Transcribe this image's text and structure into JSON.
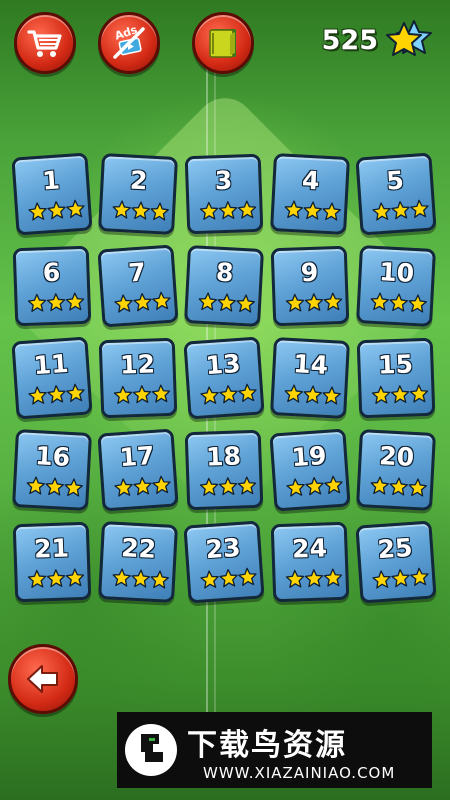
{
  "header": {
    "score": "525",
    "buttons": [
      {
        "name": "shop",
        "icon": "shopping-cart-icon"
      },
      {
        "name": "no-ads",
        "icon": "no-ads-icon",
        "label": "Ads"
      },
      {
        "name": "book",
        "icon": "book-icon"
      }
    ],
    "score_icon": "star-icon"
  },
  "levels": [
    {
      "number": "1",
      "stars": 3
    },
    {
      "number": "2",
      "stars": 3
    },
    {
      "number": "3",
      "stars": 3
    },
    {
      "number": "4",
      "stars": 3
    },
    {
      "number": "5",
      "stars": 3
    },
    {
      "number": "6",
      "stars": 3
    },
    {
      "number": "7",
      "stars": 3
    },
    {
      "number": "8",
      "stars": 3
    },
    {
      "number": "9",
      "stars": 3
    },
    {
      "number": "10",
      "stars": 3
    },
    {
      "number": "11",
      "stars": 3
    },
    {
      "number": "12",
      "stars": 3
    },
    {
      "number": "13",
      "stars": 3
    },
    {
      "number": "14",
      "stars": 3
    },
    {
      "number": "15",
      "stars": 3
    },
    {
      "number": "16",
      "stars": 3
    },
    {
      "number": "17",
      "stars": 3
    },
    {
      "number": "18",
      "stars": 3
    },
    {
      "number": "19",
      "stars": 3
    },
    {
      "number": "20",
      "stars": 3
    },
    {
      "number": "21",
      "stars": 3
    },
    {
      "number": "22",
      "stars": 3
    },
    {
      "number": "23",
      "stars": 3
    },
    {
      "number": "24",
      "stars": 3
    },
    {
      "number": "25",
      "stars": 3
    }
  ],
  "footer": {
    "back_icon": "back-arrow-icon"
  },
  "watermark": {
    "title": "下载鸟资源",
    "url": "WWW.XIAZAINIAO.COM"
  },
  "colors": {
    "tile": "#5fa2d6",
    "star": "#ffd400",
    "button": "#d32a15",
    "background": "#58b242"
  }
}
